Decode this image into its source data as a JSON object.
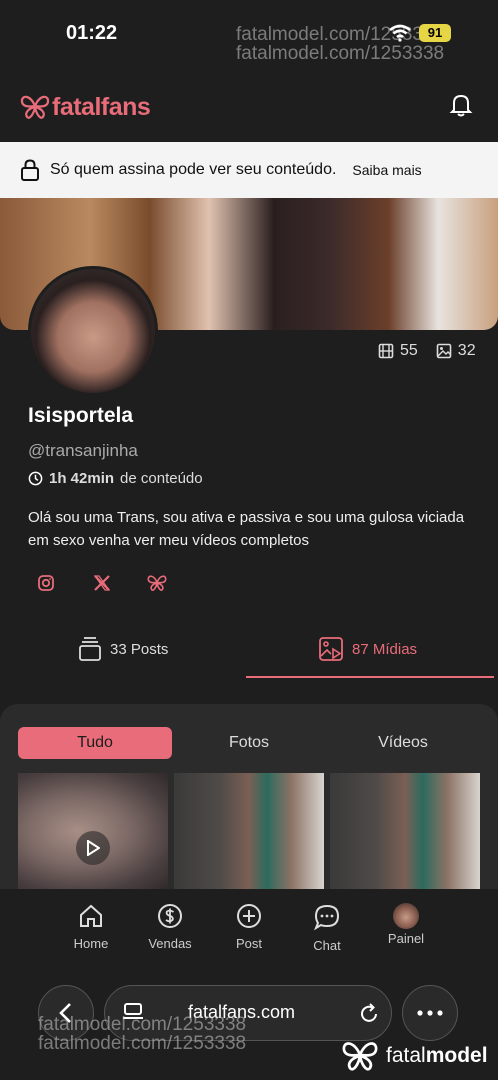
{
  "status": {
    "time": "01:22",
    "battery": "91"
  },
  "watermarks": [
    "fatalmodel.com/1253338",
    "fatalmodel.com/1253338",
    "fatalmodel.com/1253338",
    "fatalmodel.com/1253338"
  ],
  "brand": {
    "name": "fatalfans",
    "accent": "#e86c79"
  },
  "lock_notice": {
    "text": "Só quem assina pode ver seu conteúdo.",
    "link": "Saiba mais"
  },
  "profile": {
    "video_count": "55",
    "photo_count": "32",
    "name": "Isisportela",
    "handle": "@transanjinha",
    "duration_value": "1h 42min",
    "duration_suffix": "de conteúdo",
    "bio": "Olá sou uma Trans, sou ativa e passiva e sou uma gulosa viciada em sexo venha ver meu vídeos completos"
  },
  "social": [
    "instagram-icon",
    "x-icon",
    "fatalfans-icon"
  ],
  "tabs": [
    {
      "label": "33 Posts",
      "active": false
    },
    {
      "label": "87 Mídias",
      "active": true
    }
  ],
  "filters": [
    {
      "label": "Tudo",
      "active": true
    },
    {
      "label": "Fotos",
      "active": false
    },
    {
      "label": "Vídeos",
      "active": false
    }
  ],
  "bottom_nav": [
    {
      "label": "Home",
      "icon": "home-icon"
    },
    {
      "label": "Vendas",
      "icon": "dollar-icon"
    },
    {
      "label": "Post",
      "icon": "plus-icon"
    },
    {
      "label": "Chat",
      "icon": "chat-icon"
    },
    {
      "label": "Painel",
      "icon": "avatar-icon"
    }
  ],
  "browser": {
    "url": "fatalfans.com"
  },
  "footer_logo": {
    "prefix": "fatal",
    "suffix": "model"
  }
}
